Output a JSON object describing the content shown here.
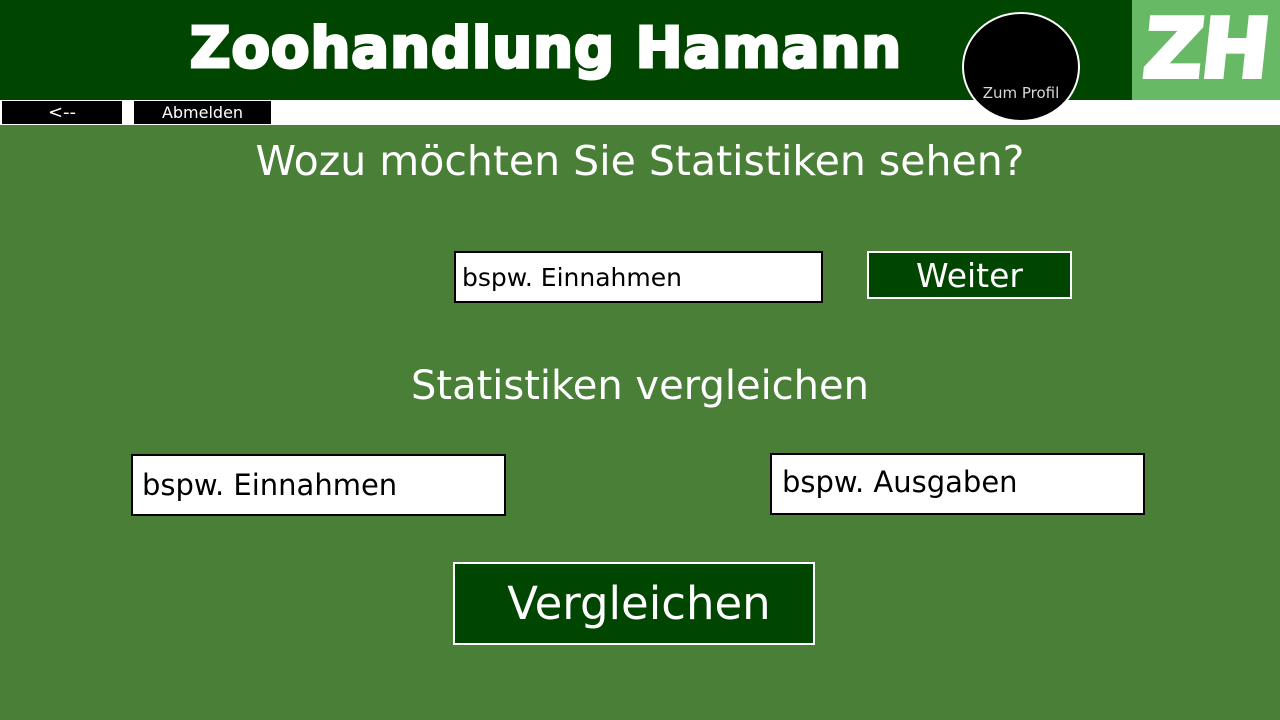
{
  "header": {
    "title": "Zoohandlung Hamann",
    "logo_text": "ZH",
    "profile_label": "Zum Profil"
  },
  "nav": {
    "back_label": "<--",
    "logout_label": "Abmelden"
  },
  "main": {
    "question": "Wozu möchten Sie Statistiken sehen?",
    "statistic_placeholder": "bspw. Einnahmen",
    "weiter_label": "Weiter",
    "compare_heading": "Statistiken vergleichen",
    "compare_left_placeholder": "bspw. Einnahmen",
    "compare_right_placeholder": "bspw. Ausgaben",
    "compare_label": "Vergleichen"
  },
  "colors": {
    "background": "#4a7f38",
    "header": "#004500",
    "logo_bg": "#67b966",
    "button": "#004500"
  }
}
